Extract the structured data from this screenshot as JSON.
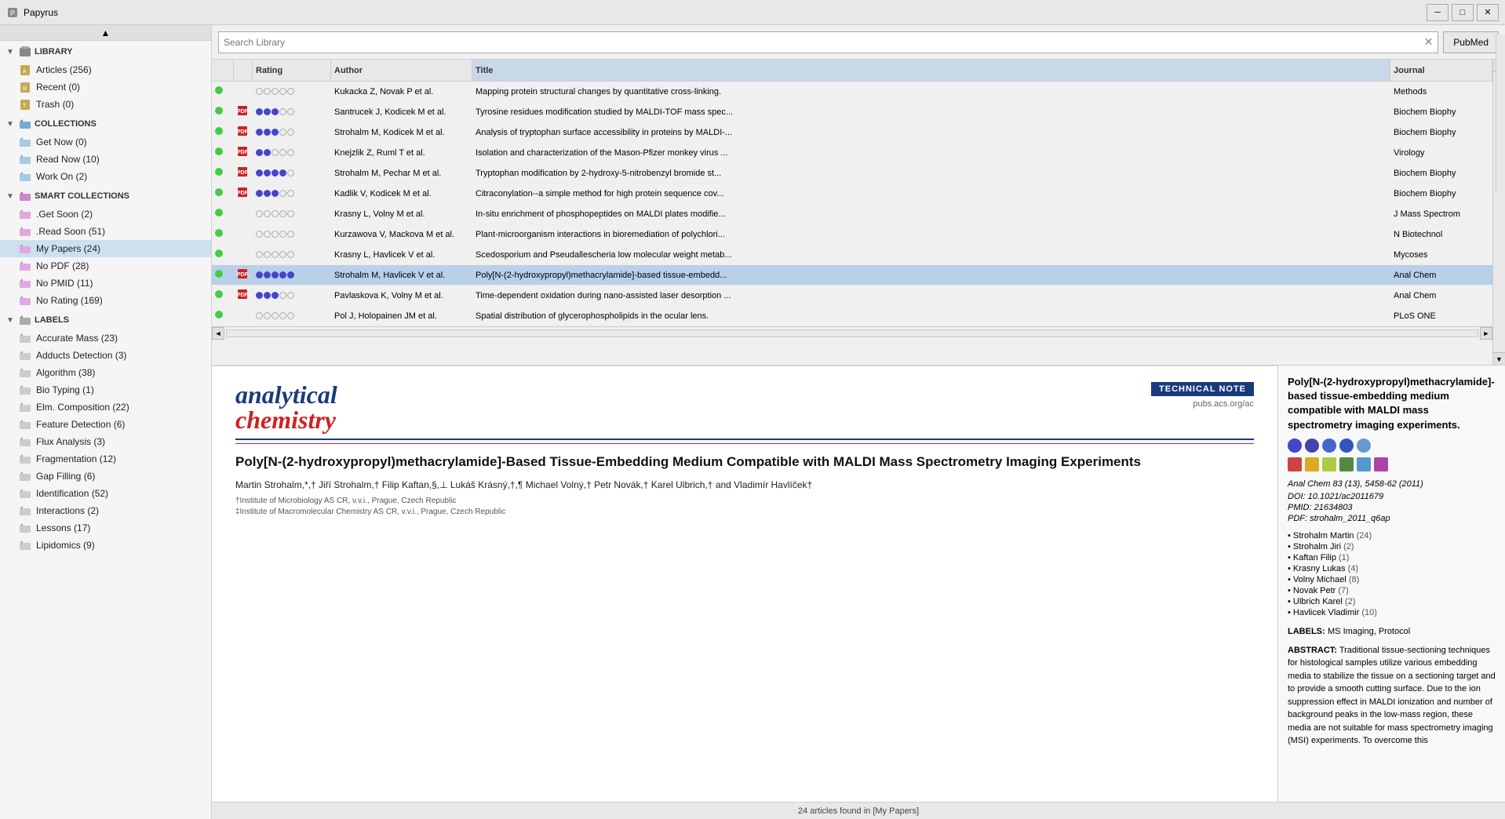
{
  "titleBar": {
    "appName": "Papyrus",
    "iconColor": "#555",
    "minimizeLabel": "─",
    "maximizeLabel": "□",
    "closeLabel": "✕"
  },
  "sidebar": {
    "library": {
      "label": "LIBRARY",
      "items": [
        {
          "label": "Articles (256)",
          "icon": "articles"
        },
        {
          "label": "Recent (0)",
          "icon": "recent"
        },
        {
          "label": "Trash (0)",
          "icon": "trash"
        }
      ]
    },
    "collections": {
      "label": "COLLECTIONS",
      "items": [
        {
          "label": "Get Now (0)",
          "icon": "folder"
        },
        {
          "label": "Read Now (10)",
          "icon": "folder"
        },
        {
          "label": "Work On (2)",
          "icon": "folder"
        }
      ]
    },
    "smartCollections": {
      "label": "SMART COLLECTIONS",
      "items": [
        {
          "label": ".Get Soon (2)",
          "icon": "smart"
        },
        {
          "label": ".Read Soon (51)",
          "icon": "smart"
        },
        {
          "label": "My Papers (24)",
          "icon": "smart",
          "selected": true
        },
        {
          "label": "No PDF (28)",
          "icon": "smart"
        },
        {
          "label": "No PMID (11)",
          "icon": "smart"
        },
        {
          "label": "No Rating (169)",
          "icon": "smart"
        }
      ]
    },
    "labels": {
      "label": "LABELS",
      "items": [
        {
          "label": "Accurate Mass (23)",
          "icon": "label"
        },
        {
          "label": "Adducts Detection (3)",
          "icon": "label"
        },
        {
          "label": "Algorithm (38)",
          "icon": "label"
        },
        {
          "label": "Bio Typing (1)",
          "icon": "label"
        },
        {
          "label": "Elm. Composition (22)",
          "icon": "label"
        },
        {
          "label": "Feature Detection (6)",
          "icon": "label"
        },
        {
          "label": "Flux Analysis (3)",
          "icon": "label"
        },
        {
          "label": "Fragmentation (12)",
          "icon": "label"
        },
        {
          "label": "Gap Filling (6)",
          "icon": "label"
        },
        {
          "label": "Identification (52)",
          "icon": "label"
        },
        {
          "label": "Interactions (2)",
          "icon": "label"
        },
        {
          "label": "Lessons (17)",
          "icon": "label"
        },
        {
          "label": "Lipidomics (9)",
          "icon": "label"
        }
      ]
    }
  },
  "toolbar": {
    "searchPlaceholder": "Search Library",
    "searchValue": "",
    "pubmedLabel": "PubMed"
  },
  "table": {
    "columns": [
      "",
      "",
      "Rating",
      "Author",
      "Title",
      "Journal"
    ],
    "rows": [
      {
        "hasGreen": true,
        "hasPdf": false,
        "rating": [
          0,
          0,
          0,
          0,
          0
        ],
        "author": "Kukacka Z, Novak P et al.",
        "title": "Mapping protein structural changes by quantitative cross-linking.",
        "journal": "Methods",
        "selected": false
      },
      {
        "hasGreen": true,
        "hasPdf": true,
        "rating": [
          1,
          1,
          1,
          0,
          0
        ],
        "author": "Santrucek J, Kodicek M et al.",
        "title": "Tyrosine residues modification studied by MALDI-TOF mass spec...",
        "journal": "Biochem Biophy",
        "selected": false
      },
      {
        "hasGreen": true,
        "hasPdf": true,
        "rating": [
          1,
          1,
          1,
          0,
          0
        ],
        "author": "Strohalm M, Kodicek M et al.",
        "title": "Analysis of tryptophan surface accessibility in proteins by MALDI-...",
        "journal": "Biochem Biophy",
        "selected": false
      },
      {
        "hasGreen": true,
        "hasPdf": true,
        "rating": [
          1,
          1,
          0,
          0,
          0
        ],
        "author": "Knejzlik Z, Ruml T et al.",
        "title": "Isolation and characterization of the Mason-Pfizer monkey virus ...",
        "journal": "Virology",
        "selected": false
      },
      {
        "hasGreen": true,
        "hasPdf": true,
        "rating": [
          1,
          1,
          1,
          1,
          0
        ],
        "author": "Strohalm M, Pechar M et al.",
        "title": "Tryptophan modification by 2-hydroxy-5-nitrobenzyl bromide st...",
        "journal": "Biochem Biophy",
        "selected": false
      },
      {
        "hasGreen": true,
        "hasPdf": true,
        "rating": [
          1,
          1,
          1,
          0,
          0
        ],
        "author": "Kadlik V, Kodicek M et al.",
        "title": "Citraconylation--a simple method for high protein sequence cov...",
        "journal": "Biochem Biophy",
        "selected": false
      },
      {
        "hasGreen": true,
        "hasPdf": false,
        "rating": [
          0,
          0,
          0,
          0,
          0
        ],
        "author": "Krasny L, Volny M et al.",
        "title": "In-situ enrichment of phosphopeptides on MALDI plates modifie...",
        "journal": "J Mass Spectrom",
        "selected": false
      },
      {
        "hasGreen": true,
        "hasPdf": false,
        "rating": [
          0,
          0,
          0,
          0,
          0
        ],
        "author": "Kurzawova V, Mackova M et al.",
        "title": "Plant-microorganism interactions in bioremediation of polychlori...",
        "journal": "N Biotechnol",
        "selected": false
      },
      {
        "hasGreen": true,
        "hasPdf": false,
        "rating": [
          0,
          0,
          0,
          0,
          0
        ],
        "author": "Krasny L, Havlicek V et al.",
        "title": "Scedosporium and Pseudallescheria low molecular weight metab...",
        "journal": "Mycoses",
        "selected": false
      },
      {
        "hasGreen": true,
        "hasPdf": true,
        "rating": [
          1,
          1,
          1,
          1,
          1
        ],
        "author": "Strohalm M, Havlicek V et al.",
        "title": "Poly[N-(2-hydroxypropyl)methacrylamide]-based tissue-embedd...",
        "journal": "Anal Chem",
        "selected": true
      },
      {
        "hasGreen": true,
        "hasPdf": true,
        "rating": [
          1,
          1,
          1,
          0,
          0
        ],
        "author": "Pavlaskova K, Volny M et al.",
        "title": "Time-dependent oxidation during nano-assisted laser desorption ...",
        "journal": "Anal Chem",
        "selected": false
      },
      {
        "hasGreen": true,
        "hasPdf": false,
        "rating": [
          0,
          0,
          0,
          0,
          0
        ],
        "author": "Pol J, Holopainen JM et al.",
        "title": "Spatial distribution of glycerophospholipids in the ocular lens.",
        "journal": "PLoS ONE",
        "selected": false
      }
    ]
  },
  "preview": {
    "journalLine1": "analytical",
    "journalLine2": "chemistry",
    "technicalNote": "TECHNICAL NOTE",
    "acsUrl": "pubs.acs.org/ac",
    "title": "Poly[N-(2-hydroxypropyl)methacrylamide]-Based Tissue-Embedding Medium Compatible with MALDI Mass Spectrometry Imaging Experiments",
    "authors": "Martin Strohalm,*,† Jiří Strohalm,† Filip Kaftan,§,⊥ Lukáš Krásný,†,¶ Michael Volný,† Petr Novák,† Karel Ulbrich,† and Vladimír Havlíček†",
    "affiliation1": "†Institute of Microbiology AS CR, v.v.i., Prague, Czech Republic",
    "affiliation2": "‡Institute of Macromolecular Chemistry AS CR, v.v.i., Prague, Czech Republic"
  },
  "detail": {
    "title": "Poly[N-(2-hydroxypropyl)methacrylamide]-based tissue-embedding medium compatible with MALDI mass spectrometry imaging experiments.",
    "colorDots": [
      "#4444cc",
      "#4444aa",
      "#4466cc",
      "#3355bb",
      "#6699cc"
    ],
    "colorSquares": [
      "#cc4444",
      "#ddaa22",
      "#aacc44",
      "#558844",
      "#5599cc",
      "#aa44aa"
    ],
    "journalRef": "Anal Chem 83 (13), 5458-62 (2011)",
    "doi": "DOI: 10.1021/ac2011679",
    "pmid": "PMID: 21634803",
    "pdfFile": "PDF: strohalm_2011_q6ap",
    "authors": [
      {
        "name": "Strohalm Martin",
        "count": "(24)"
      },
      {
        "name": "Strohalm Jiri",
        "count": "(2)"
      },
      {
        "name": "Kaftan Filip",
        "count": "(1)"
      },
      {
        "name": "Krasny Lukas",
        "count": "(4)"
      },
      {
        "name": "Volny Michael",
        "count": "(8)"
      },
      {
        "name": "Novak Petr",
        "count": "(7)"
      },
      {
        "name": "Ulbrich Karel",
        "count": "(2)"
      },
      {
        "name": "Havlicek Vladimir",
        "count": "(10)"
      }
    ],
    "labelsTitle": "LABELS:",
    "labelsValue": "MS Imaging, Protocol",
    "abstractTitle": "ABSTRACT:",
    "abstractText": "Traditional tissue-sectioning techniques for histological samples utilize various embedding media to stabilize the tissue on a sectioning target and to provide a smooth cutting surface. Due to the ion suppression effect in MALDI ionization and number of background peaks in the low-mass region, these media are not suitable for mass spectrometry imaging (MSI) experiments. To overcome this"
  },
  "statusBar": {
    "text": "24 articles found in [My Papers]"
  }
}
